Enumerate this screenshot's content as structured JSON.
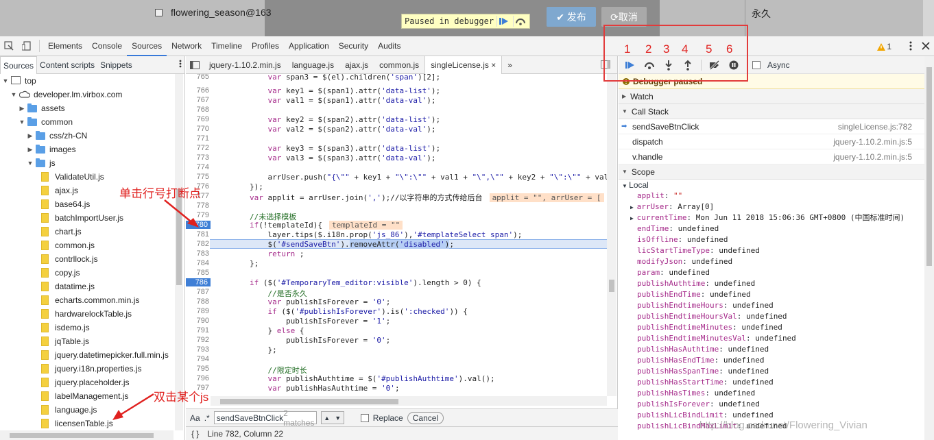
{
  "page": {
    "email": "flowering_season@163",
    "publish_btn": "✔ 发布",
    "cancel_btn": "⟳取消",
    "forever": "永久",
    "paused_text": "Paused in debugger"
  },
  "devtools": {
    "tabs": [
      "Elements",
      "Console",
      "Sources",
      "Network",
      "Timeline",
      "Profiles",
      "Application",
      "Security",
      "Audits"
    ],
    "selected_tab": "Sources",
    "warning_count": "1"
  },
  "navigator": {
    "tabs": [
      "Sources",
      "Content scripts",
      "Snippets"
    ],
    "tree": [
      {
        "label": "top",
        "type": "frame",
        "depth": 0,
        "open": true
      },
      {
        "label": "developer.lm.virbox.com",
        "type": "cloud",
        "depth": 1,
        "open": true
      },
      {
        "label": "assets",
        "type": "folder",
        "depth": 2,
        "open": false
      },
      {
        "label": "common",
        "type": "folder",
        "depth": 2,
        "open": true
      },
      {
        "label": "css/zh-CN",
        "type": "folder",
        "depth": 3,
        "open": false
      },
      {
        "label": "images",
        "type": "folder",
        "depth": 3,
        "open": false
      },
      {
        "label": "js",
        "type": "folder",
        "depth": 3,
        "open": true
      },
      {
        "label": "ValidateUtil.js",
        "type": "file",
        "depth": 4
      },
      {
        "label": "ajax.js",
        "type": "file",
        "depth": 4
      },
      {
        "label": "base64.js",
        "type": "file",
        "depth": 4
      },
      {
        "label": "batchImportUser.js",
        "type": "file",
        "depth": 4
      },
      {
        "label": "chart.js",
        "type": "file",
        "depth": 4
      },
      {
        "label": "common.js",
        "type": "file",
        "depth": 4
      },
      {
        "label": "contrllock.js",
        "type": "file",
        "depth": 4
      },
      {
        "label": "copy.js",
        "type": "file",
        "depth": 4
      },
      {
        "label": "datatime.js",
        "type": "file",
        "depth": 4
      },
      {
        "label": "echarts.common.min.js",
        "type": "file",
        "depth": 4
      },
      {
        "label": "hardwarelockTable.js",
        "type": "file",
        "depth": 4
      },
      {
        "label": "isdemo.js",
        "type": "file",
        "depth": 4
      },
      {
        "label": "jqTable.js",
        "type": "file",
        "depth": 4
      },
      {
        "label": "jquery.datetimepicker.full.min.js",
        "type": "file",
        "depth": 4
      },
      {
        "label": "jquery.i18n.properties.js",
        "type": "file",
        "depth": 4
      },
      {
        "label": "jquery.placeholder.js",
        "type": "file",
        "depth": 4
      },
      {
        "label": "labelManagement.js",
        "type": "file",
        "depth": 4
      },
      {
        "label": "language.js",
        "type": "file",
        "depth": 4
      },
      {
        "label": "licensenTable.js",
        "type": "file",
        "depth": 4
      }
    ]
  },
  "editor": {
    "tabs": [
      "jquery-1.10.2.min.js",
      "language.js",
      "ajax.js",
      "common.js",
      "singleLicense.js ×"
    ],
    "selected_tab": 4,
    "lines": [
      {
        "n": "765",
        "t": "            var span3 = $(el).children('span')[2];",
        "cut": true
      },
      {
        "n": "766",
        "t": "            var key1 = $(span1).attr('data-list');"
      },
      {
        "n": "767",
        "t": "            var val1 = $(span1).attr('data-val');"
      },
      {
        "n": "768",
        "t": ""
      },
      {
        "n": "769",
        "t": "            var key2 = $(span2).attr('data-list');"
      },
      {
        "n": "770",
        "t": "            var val2 = $(span2).attr('data-val');"
      },
      {
        "n": "771",
        "t": ""
      },
      {
        "n": "772",
        "t": "            var key3 = $(span3).attr('data-list');"
      },
      {
        "n": "773",
        "t": "            var val3 = $(span3).attr('data-val');"
      },
      {
        "n": "774",
        "t": ""
      },
      {
        "n": "775",
        "t": "            arrUser.push(\"{\\\"\" + key1 + \"\\\":\\\"\" + val1 + \"\\\",\\\"\" + key2 + \"\\\":\\\"\" + val"
      },
      {
        "n": "776",
        "t": "        });"
      },
      {
        "n": "777",
        "t": "        var applit = arrUser.join(',');//以字符串的方式传给后台",
        "inline": "applit = \"\", arrUser = ["
      },
      {
        "n": "778",
        "t": ""
      },
      {
        "n": "779",
        "t": "        //未选择模板"
      },
      {
        "n": "780",
        "t": "        if(!templateId){",
        "inline": "templateId = \"\"",
        "bp": true
      },
      {
        "n": "781",
        "t": "            layer.tips($.i18n.prop('js_86'),'#templateSelect span');"
      },
      {
        "n": "782",
        "t": "            $('#sendSaveBtn').removeAttr('disabled');",
        "current": true
      },
      {
        "n": "783",
        "t": "            return ;"
      },
      {
        "n": "784",
        "t": "        };"
      },
      {
        "n": "785",
        "t": ""
      },
      {
        "n": "786",
        "t": "        if ($('#TemporaryTem_editor:visible').length > 0) {",
        "bp": true
      },
      {
        "n": "787",
        "t": "            //是否永久"
      },
      {
        "n": "788",
        "t": "            var publishIsForever = '0';"
      },
      {
        "n": "789",
        "t": "            if ($('#publishIsForever').is(':checked')) {"
      },
      {
        "n": "790",
        "t": "                publishIsForever = '1';"
      },
      {
        "n": "791",
        "t": "            } else {"
      },
      {
        "n": "792",
        "t": "                publishIsForever = '0';"
      },
      {
        "n": "793",
        "t": "            };"
      },
      {
        "n": "794",
        "t": ""
      },
      {
        "n": "795",
        "t": "            //限定时长"
      },
      {
        "n": "796",
        "t": "            var publishAuthtime = $('#publishAuthtime').val();"
      },
      {
        "n": "797",
        "t": "            var publishHasAuthtime = '0';"
      }
    ],
    "search_value": "sendSaveBtnClick",
    "search_matches": "2 matches",
    "search_mode": "Aa",
    "regex": ".*",
    "replace_label": "Replace",
    "cancel_label": "Cancel",
    "status_braces": "{ }",
    "status_text": "Line 782, Column 22"
  },
  "debugger": {
    "async_label": "Async",
    "paused_msg": "Debugger paused",
    "watch": "Watch",
    "callstack": "Call Stack",
    "frames": [
      {
        "name": "sendSaveBtnClick",
        "loc": "singleLicense.js:782",
        "current": true
      },
      {
        "name": "dispatch",
        "loc": "jquery-1.10.2.min.js:5"
      },
      {
        "name": "v.handle",
        "loc": "jquery-1.10.2.min.js:5"
      }
    ],
    "scope": "Scope",
    "local": "Local",
    "vars": [
      {
        "k": "applit",
        "v": "\"\"",
        "str": true
      },
      {
        "k": "arrUser",
        "v": "Array[0]",
        "exp": true
      },
      {
        "k": "currentTime",
        "v": "Mon Jun 11 2018 15:06:36 GMT+0800 (中国标准时间)",
        "exp": true
      },
      {
        "k": "endTime",
        "v": "undefined"
      },
      {
        "k": "isOffline",
        "v": "undefined"
      },
      {
        "k": "licStartTimeType",
        "v": "undefined"
      },
      {
        "k": "modifyJson",
        "v": "undefined"
      },
      {
        "k": "param",
        "v": "undefined"
      },
      {
        "k": "publishAuthtime",
        "v": "undefined"
      },
      {
        "k": "publishEndTime",
        "v": "undefined"
      },
      {
        "k": "publishEndtimeHours",
        "v": "undefined"
      },
      {
        "k": "publishEndtimeHoursVal",
        "v": "undefined"
      },
      {
        "k": "publishEndtimeMinutes",
        "v": "undefined"
      },
      {
        "k": "publishEndtimeMinutesVal",
        "v": "undefined"
      },
      {
        "k": "publishHasAuthtime",
        "v": "undefined"
      },
      {
        "k": "publishHasEndTime",
        "v": "undefined"
      },
      {
        "k": "publishHasSpanTime",
        "v": "undefined"
      },
      {
        "k": "publishHasStartTime",
        "v": "undefined"
      },
      {
        "k": "publishHasTimes",
        "v": "undefined"
      },
      {
        "k": "publishIsForever",
        "v": "undefined"
      },
      {
        "k": "publishLicBindLimit",
        "v": "undefined"
      },
      {
        "k": "publishLicBindMaxLimit",
        "v": "undefined"
      }
    ]
  },
  "annotations": {
    "click_line": "单击行号打断点",
    "dblclick_js": "双击某个js",
    "numbers": [
      "1",
      "2",
      "3",
      "4",
      "5",
      "6"
    ],
    "watermark": "http://blog.csdn.net/Flowering_Vivian",
    "color": "#e0211f"
  }
}
